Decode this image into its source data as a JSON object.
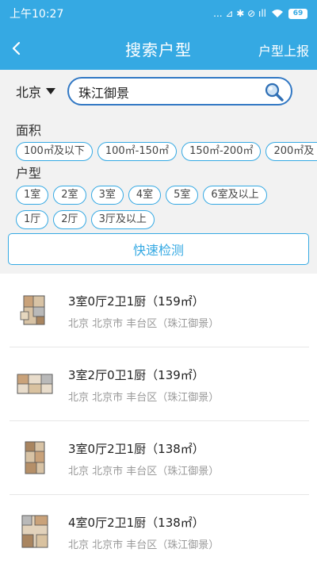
{
  "status_bar": {
    "time": "上午10:27",
    "icons": "... ⊿ ✱ ⊘ ıll",
    "battery": "69"
  },
  "header": {
    "title": "搜索户型",
    "report_label": "户型上报"
  },
  "search": {
    "city": "北京",
    "query": "珠江御景"
  },
  "filters": {
    "area_label": "面积",
    "area_options": [
      "100㎡及以下",
      "100㎡-150㎡",
      "150㎡-200㎡",
      "200㎡及"
    ],
    "layout_label": "户型",
    "room_options": [
      "1室",
      "2室",
      "3室",
      "4室",
      "5室",
      "6室及以上"
    ],
    "hall_options": [
      "1厅",
      "2厅",
      "3厅及以上"
    ]
  },
  "detect_button": "快速检测",
  "results": [
    {
      "title": "3室0厅2卫1厨（159㎡）",
      "location": "北京 北京市 丰台区（珠江御景）"
    },
    {
      "title": "3室2厅0卫1厨（139㎡）",
      "location": "北京 北京市 丰台区（珠江御景）"
    },
    {
      "title": "3室0厅2卫1厨（138㎡）",
      "location": "北京 北京市 丰台区（珠江御景）"
    },
    {
      "title": "4室0厅2卫1厨（138㎡）",
      "location": "北京 北京市 丰台区（珠江御景）"
    }
  ],
  "colors": {
    "primary": "#35a9e3",
    "search_border": "#3278c4"
  },
  "icons": {
    "back": "chevron-left-icon",
    "search": "magnifier-icon",
    "city_dropdown": "triangle-down-icon",
    "floorplan": "floorplan-thumbnail-icon"
  }
}
